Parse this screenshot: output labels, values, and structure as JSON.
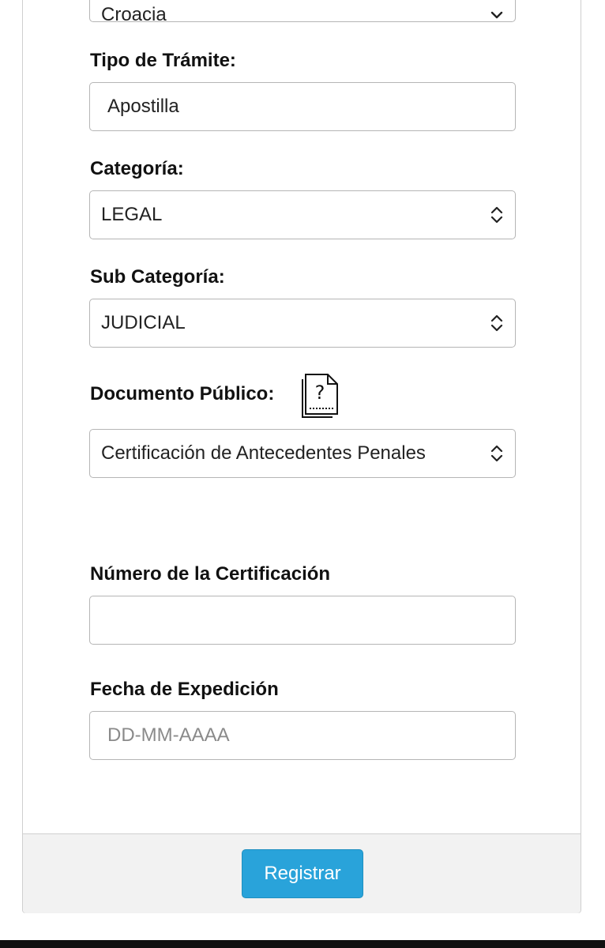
{
  "form": {
    "country": {
      "value": "Croacia"
    },
    "tramite": {
      "label": "Tipo de Trámite:",
      "value": "Apostilla"
    },
    "categoria": {
      "label": "Categoría:",
      "value": "LEGAL"
    },
    "subcategoria": {
      "label": "Sub Categoría:",
      "value": "JUDICIAL"
    },
    "documento": {
      "label": "Documento Público:",
      "value": "Certificación de Antecedentes Penales",
      "help_icon": "document-question-icon"
    },
    "numero": {
      "label": "Número de la Certificación",
      "value": ""
    },
    "fecha": {
      "label": "Fecha de Expedición",
      "placeholder": "DD-MM-AAAA",
      "value": ""
    }
  },
  "footer": {
    "submit_label": "Registrar"
  },
  "colors": {
    "primary_button": "#29a3da",
    "border": "#b5b5b5",
    "footer_bg": "#f2f2f2"
  }
}
